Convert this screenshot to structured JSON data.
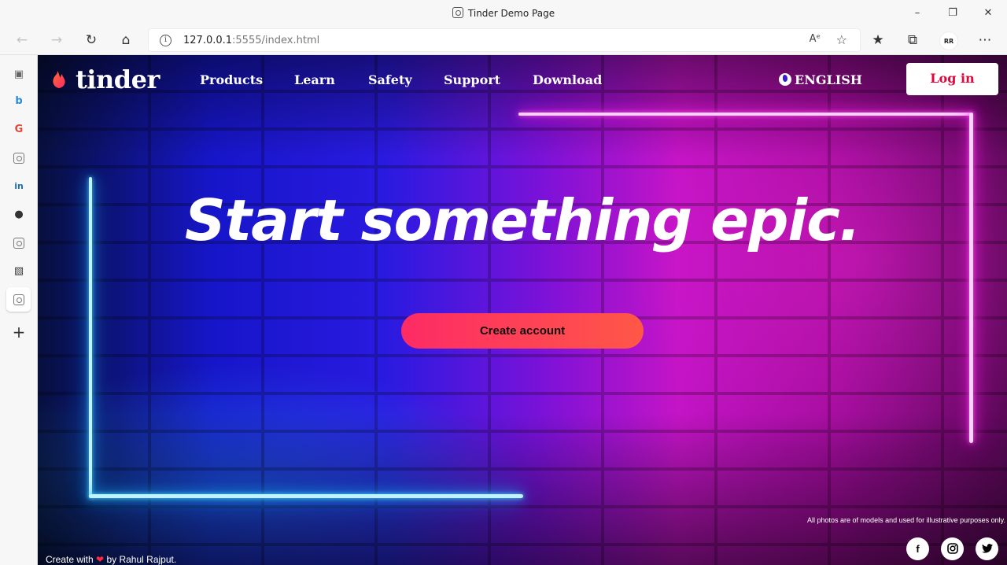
{
  "window": {
    "title": "Tinder Demo Page"
  },
  "browser": {
    "url_host": "127.0.0.1",
    "url_rest": ":5555/index.html",
    "profile_initials": "RR"
  },
  "site": {
    "logo_text": "tinder",
    "nav": [
      "Products",
      "Learn",
      "Safety",
      "Support",
      "Download"
    ],
    "language": "ENGLISH",
    "login_label": "Log in",
    "headline": "Start something epic.",
    "cta_label": "Create account",
    "disclaimer": "All photos are of models and used for illustrative purposes only.",
    "credit_prefix": "Create with",
    "credit_suffix": "by Rahul Rajput."
  },
  "colors": {
    "brand": "#fd2b65",
    "login_text": "#e6053b",
    "neon_blue": "#48d5ff",
    "neon_pink": "#ff24e6"
  },
  "icons": {
    "sidebar": [
      "tabs-icon",
      "bing-icon",
      "copilot-icon",
      "radio-icon",
      "linkedin-icon",
      "github-icon",
      "radio-icon",
      "office-icon",
      "radio-icon",
      "add-icon"
    ],
    "social": [
      "facebook-icon",
      "instagram-icon",
      "twitter-icon"
    ]
  }
}
